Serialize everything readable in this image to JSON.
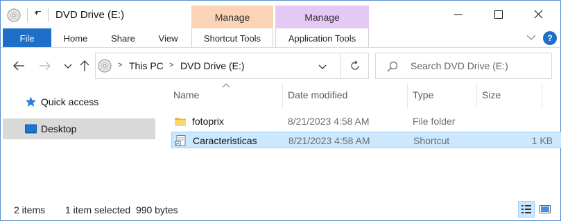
{
  "titlebar": {
    "title": "DVD Drive (E:)",
    "context_groups": [
      {
        "label": "Manage",
        "color": "#fbd3b6"
      },
      {
        "label": "Manage",
        "color": "#e4c9f5"
      }
    ],
    "minimize": "—",
    "maximize": "☐",
    "close": "✕"
  },
  "ribbon": {
    "tabs": [
      "File",
      "Home",
      "Share",
      "View",
      "Shortcut Tools",
      "Application Tools"
    ],
    "help": "?"
  },
  "address": {
    "crumbs": [
      "This PC",
      "DVD Drive (E:)"
    ]
  },
  "search": {
    "placeholder": "Search DVD Drive (E:)"
  },
  "navpane": {
    "items": [
      {
        "label": "Quick access",
        "icon": "star-icon",
        "selected": false
      },
      {
        "label": "Desktop",
        "icon": "desktop-icon",
        "selected": true
      }
    ]
  },
  "columns": [
    "Name",
    "Date modified",
    "Type",
    "Size"
  ],
  "files": [
    {
      "name": "fotoprix",
      "date": "8/21/2023 4:58 AM",
      "type": "File folder",
      "size": "",
      "icon": "folder-icon",
      "selected": false
    },
    {
      "name": "Caracteristicas",
      "date": "8/21/2023 4:58 AM",
      "type": "Shortcut",
      "size": "1 KB",
      "icon": "shortcut-icon",
      "selected": true
    }
  ],
  "status": {
    "count": "2 items",
    "selection": "1 item selected  990 bytes"
  },
  "colors": {
    "accent": "#1d6fc7",
    "selection": "#cce8ff",
    "selection_border": "#99d1ff",
    "nav_selected": "#d9d9d9"
  }
}
